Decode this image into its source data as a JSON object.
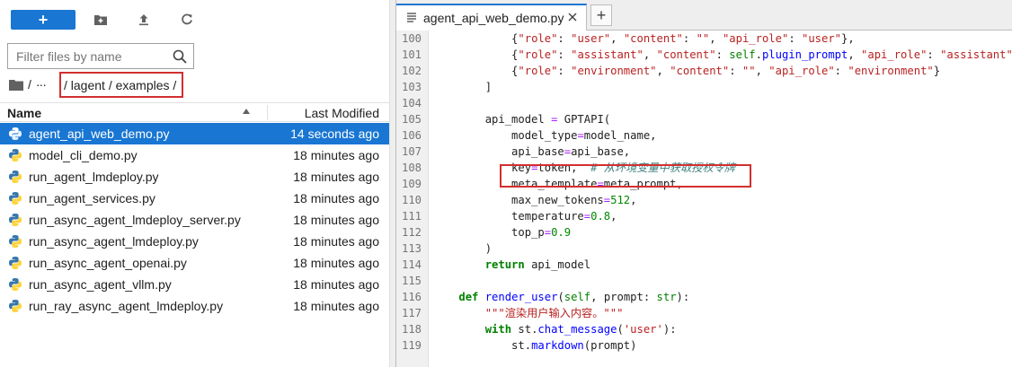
{
  "toolbar": {
    "new_label": "+",
    "new_folder_icon": "new-folder-icon",
    "upload_icon": "upload-icon",
    "refresh_icon": "refresh-icon"
  },
  "search": {
    "placeholder": "Filter files by name",
    "value": ""
  },
  "breadcrumb": {
    "root_sep": "/",
    "ellipsis": "···",
    "path": "/ lagent / examples /"
  },
  "list": {
    "col_name": "Name",
    "col_modified": "Last Modified",
    "files": [
      {
        "name": "agent_api_web_demo.py",
        "modified": "14 seconds ago",
        "selected": true
      },
      {
        "name": "model_cli_demo.py",
        "modified": "18 minutes ago"
      },
      {
        "name": "run_agent_lmdeploy.py",
        "modified": "18 minutes ago"
      },
      {
        "name": "run_agent_services.py",
        "modified": "18 minutes ago"
      },
      {
        "name": "run_async_agent_lmdeploy_server.py",
        "modified": "18 minutes ago"
      },
      {
        "name": "run_async_agent_lmdeploy.py",
        "modified": "18 minutes ago"
      },
      {
        "name": "run_async_agent_openai.py",
        "modified": "18 minutes ago"
      },
      {
        "name": "run_async_agent_vllm.py",
        "modified": "18 minutes ago"
      },
      {
        "name": "run_ray_async_agent_lmdeploy.py",
        "modified": "18 minutes ago"
      }
    ]
  },
  "editor": {
    "tab_label": "agent_api_web_demo.py",
    "add_tab_label": "+",
    "lines": [
      {
        "n": "100",
        "t": "            {\"role\": \"user\", \"content\": \"\", \"api_role\": \"user\"},"
      },
      {
        "n": "101",
        "t": "            {\"role\": \"assistant\", \"content\": self.plugin_prompt, \"api_role\": \"assistant\"},"
      },
      {
        "n": "102",
        "t": "            {\"role\": \"environment\", \"content\": \"\", \"api_role\": \"environment\"}"
      },
      {
        "n": "103",
        "t": "        ]"
      },
      {
        "n": "104",
        "t": ""
      },
      {
        "n": "105",
        "t": "        api_model = GPTAPI("
      },
      {
        "n": "106",
        "t": "            model_type=model_name,"
      },
      {
        "n": "107",
        "t": "            api_base=api_base,"
      },
      {
        "n": "108",
        "t": "            key=token,  # 从环境变量中获取授权令牌"
      },
      {
        "n": "109",
        "t": "            meta_template=meta_prompt,"
      },
      {
        "n": "110",
        "t": "            max_new_tokens=512,"
      },
      {
        "n": "111",
        "t": "            temperature=0.8,"
      },
      {
        "n": "112",
        "t": "            top_p=0.9"
      },
      {
        "n": "113",
        "t": "        )"
      },
      {
        "n": "114",
        "t": "        return api_model"
      },
      {
        "n": "115",
        "t": ""
      },
      {
        "n": "116",
        "t": "    def render_user(self, prompt: str):"
      },
      {
        "n": "117",
        "t": "        \"\"\"渲染用户输入内容。\"\"\""
      },
      {
        "n": "118",
        "t": "        with st.chat_message('user'):"
      },
      {
        "n": "119",
        "t": "            st.markdown(prompt)"
      }
    ]
  },
  "colors": {
    "accent": "#1976d2",
    "highlight_border": "#d32f2f"
  }
}
